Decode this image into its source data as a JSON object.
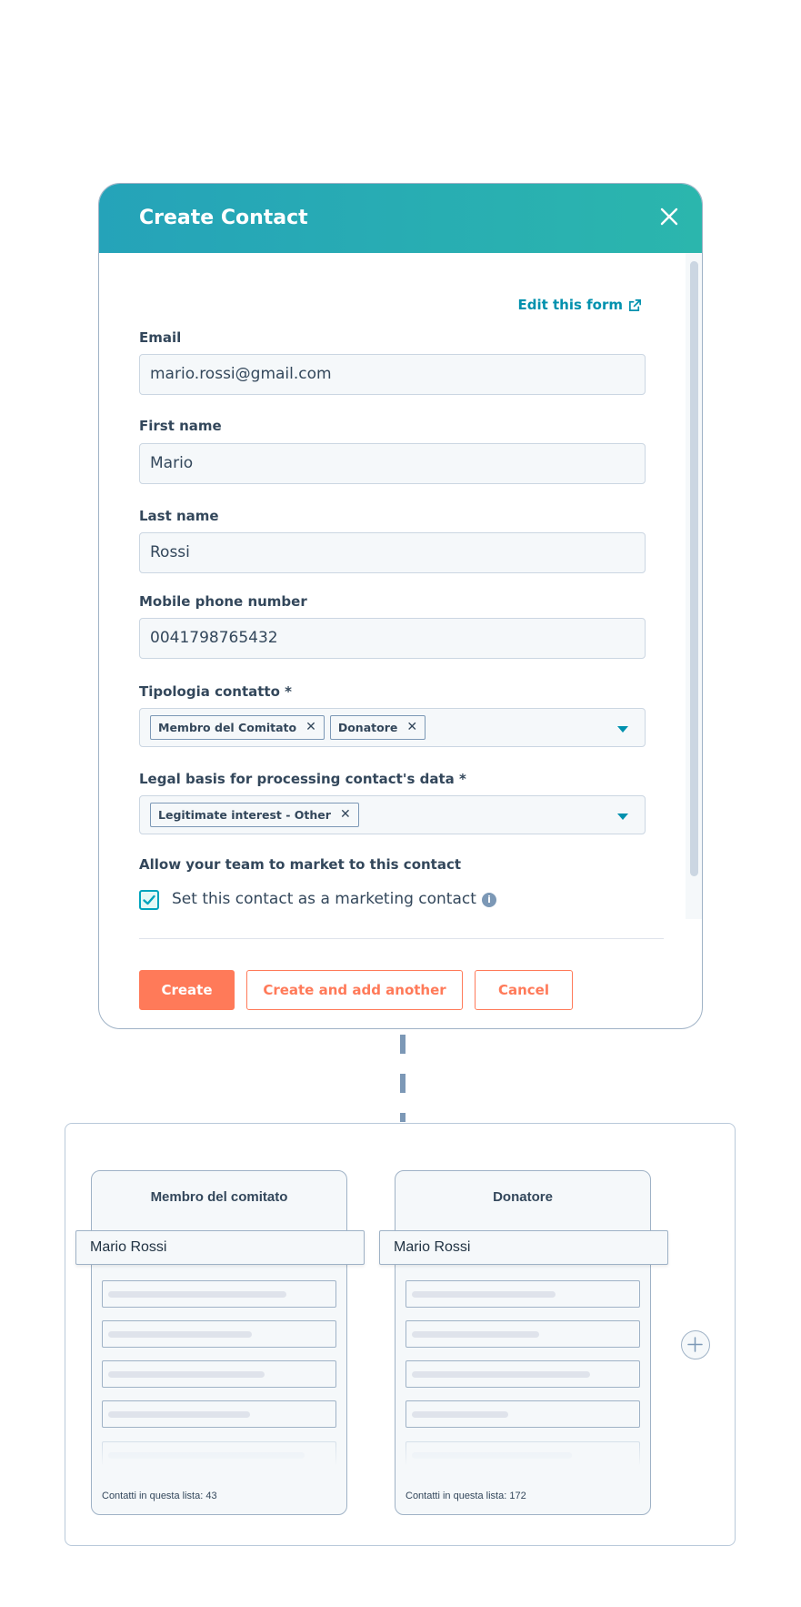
{
  "modal": {
    "title": "Create Contact",
    "edit_link": "Edit this form",
    "fields": {
      "email": {
        "label": "Email",
        "value": "mario.rossi@gmail.com"
      },
      "first_name": {
        "label": "First name",
        "value": "Mario"
      },
      "last_name": {
        "label": "Last name",
        "value": "Rossi"
      },
      "mobile": {
        "label": "Mobile phone number",
        "value": "0041798765432"
      },
      "tipologia": {
        "label": "Tipologia contatto *",
        "tags": [
          "Membro del Comitato",
          "Donatore"
        ]
      },
      "legal_basis": {
        "label": "Legal basis for processing contact's data *",
        "tags": [
          "Legitimate interest - Other"
        ]
      }
    },
    "marketing": {
      "heading": "Allow your team to market to this contact",
      "checkbox_label": "Set this contact as a marketing contact",
      "checked": true
    },
    "buttons": {
      "create": "Create",
      "create_another": "Create and add another",
      "cancel": "Cancel"
    }
  },
  "board": {
    "lists": [
      {
        "title": "Membro del comitato",
        "dragged_contact": "Mario Rossi",
        "footer": "Contatti in questa lista: 43"
      },
      {
        "title": "Donatore",
        "dragged_contact": "Mario Rossi",
        "footer": "Contatti in questa lista: 172"
      }
    ]
  },
  "colors": {
    "header_gradient_start": "#25a3b9",
    "header_gradient_end": "#2bb6ad",
    "primary_button": "#ff7a59",
    "link": "#0091ae",
    "border": "#9fb2c6"
  }
}
